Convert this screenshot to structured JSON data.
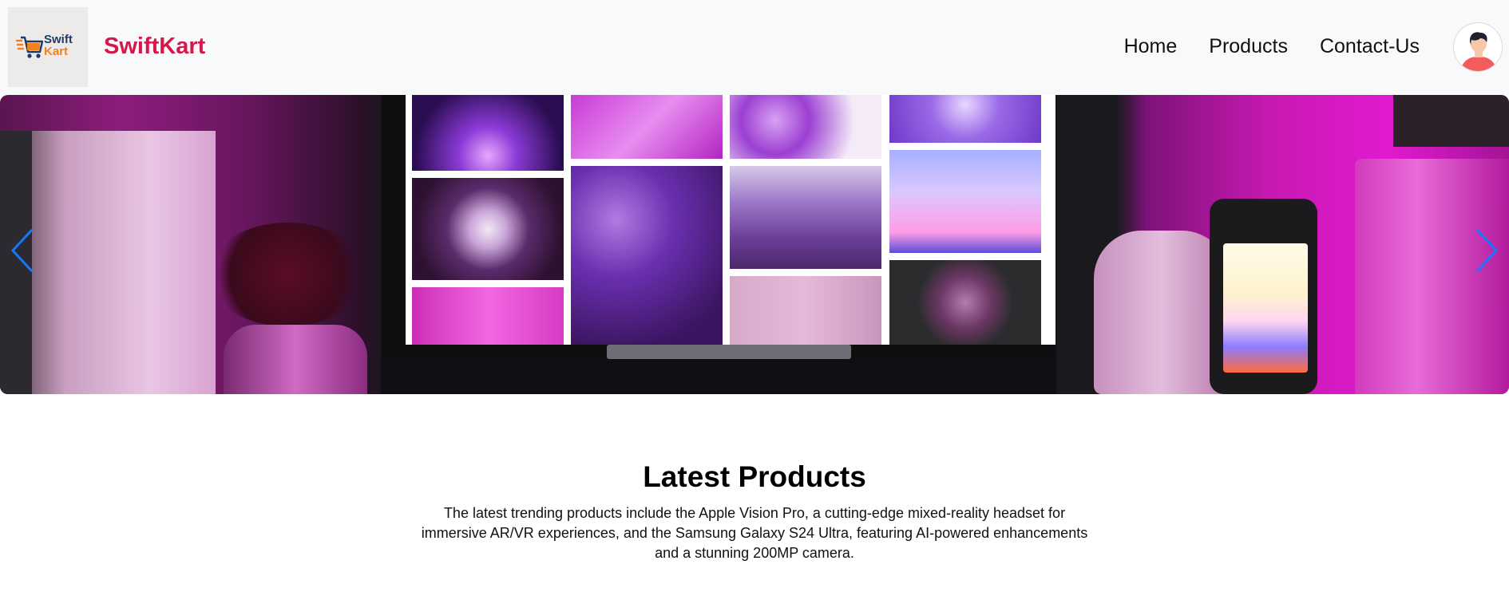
{
  "header": {
    "logo_line1": "Swift",
    "logo_line2": "Kart",
    "brand_name": "SwiftKart",
    "nav": [
      {
        "label": "Home"
      },
      {
        "label": "Products"
      },
      {
        "label": "Contact-Us"
      }
    ],
    "brand_color": "#d5174a"
  },
  "carousel": {
    "arrow_color": "#1677ff"
  },
  "latest": {
    "title": "Latest Products",
    "description": "The latest trending products include the Apple Vision Pro, a cutting-edge mixed-reality headset for immersive AR/VR experiences, and the Samsung Galaxy S24 Ultra, featuring AI-powered enhancements and a stunning 200MP camera."
  },
  "icons": [
    "cart-icon",
    "avatar-icon",
    "chevron-left-icon",
    "chevron-right-icon"
  ]
}
